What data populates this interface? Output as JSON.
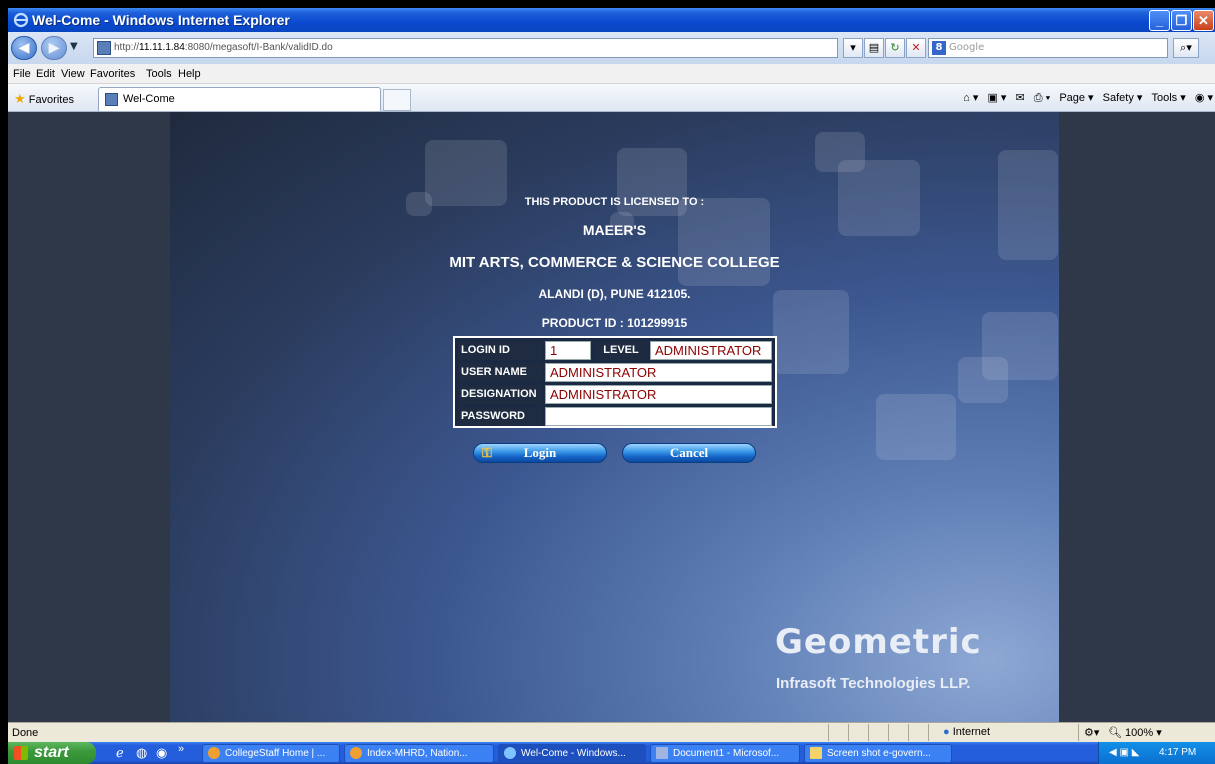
{
  "window": {
    "title": "Wel-Come - Windows Internet Explorer",
    "minimize": "_",
    "maximize": "❐",
    "close": "✕"
  },
  "address": {
    "url_prefix": "http://",
    "url_host": "11.11.1.84",
    "url_rest": ":8080/megasoft/I-Bank/validID.do",
    "search_placeholder": "Google"
  },
  "menu": [
    "File",
    "Edit",
    "View",
    "Favorites",
    "Tools",
    "Help"
  ],
  "favbar": {
    "favorites_label": "Favorites",
    "tab_label": "Wel-Come",
    "commands": [
      "Page ▾",
      "Safety ▾",
      "Tools ▾"
    ]
  },
  "page": {
    "licensed_to": "THIS PRODUCT IS LICENSED TO :",
    "org_line1": "MAEER'S",
    "org_line2": "MIT ARTS, COMMERCE & SCIENCE COLLEGE",
    "address": "ALANDI (D), PUNE 412105.",
    "product_id": "PRODUCT ID : 101299915",
    "form": {
      "login_id_label": "LOGIN ID",
      "login_id_value": "1",
      "level_label": "LEVEL",
      "level_value": "ADMINISTRATOR",
      "user_name_label": "USER NAME",
      "user_name_value": "ADMINISTRATOR",
      "designation_label": "DESIGNATION",
      "designation_value": "ADMINISTRATOR",
      "password_label": "PASSWORD",
      "password_value": ""
    },
    "login_button": "Login",
    "cancel_button": "Cancel",
    "brand": "Geometric",
    "brand_sub": "Infrasoft Technologies LLP."
  },
  "status": {
    "text": "Done",
    "zone": "Internet",
    "zoom": "100%"
  },
  "taskbar": {
    "start": "start",
    "tasks": [
      "CollegeStaff Home | ...",
      "Index-MHRD, Nation...",
      "Wel-Come - Windows...",
      "Document1 - Microsof...",
      "Screen shot e-govern..."
    ],
    "clock": "4:17 PM"
  }
}
